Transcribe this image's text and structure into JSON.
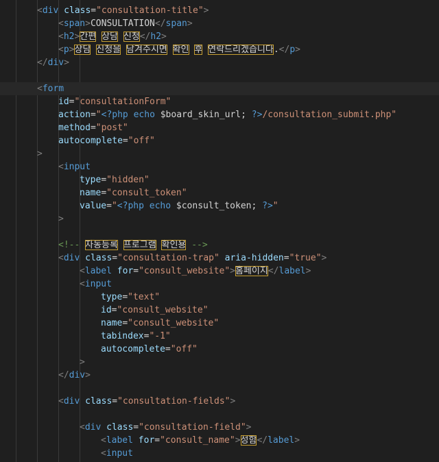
{
  "editor": {
    "lines": [
      {
        "indent": 1,
        "tokens": [
          [
            "p",
            "<"
          ],
          [
            "t",
            "div"
          ],
          [
            "x",
            " "
          ],
          [
            "a",
            "class"
          ],
          [
            "x",
            "="
          ],
          [
            "s",
            "\"consultation-title\""
          ],
          [
            "p",
            ">"
          ]
        ]
      },
      {
        "indent": 2,
        "tokens": [
          [
            "p",
            "<"
          ],
          [
            "t",
            "span"
          ],
          [
            "p",
            ">"
          ],
          [
            "x",
            "CONSULTATION"
          ],
          [
            "p",
            "</"
          ],
          [
            "t",
            "span"
          ],
          [
            "p",
            ">"
          ]
        ]
      },
      {
        "indent": 2,
        "tokens": [
          [
            "p",
            "<"
          ],
          [
            "t",
            "h2"
          ],
          [
            "p",
            ">"
          ],
          [
            "hl",
            "간편"
          ],
          [
            "x",
            " "
          ],
          [
            "hl",
            "상담"
          ],
          [
            "x",
            " "
          ],
          [
            "hl",
            "신청"
          ],
          [
            "p",
            "</"
          ],
          [
            "t",
            "h2"
          ],
          [
            "p",
            ">"
          ]
        ]
      },
      {
        "indent": 2,
        "tokens": [
          [
            "p",
            "<"
          ],
          [
            "t",
            "p"
          ],
          [
            "p",
            ">"
          ],
          [
            "hl",
            "상담"
          ],
          [
            "x",
            " "
          ],
          [
            "hl",
            "신청을"
          ],
          [
            "x",
            " "
          ],
          [
            "hl",
            "남겨주시면"
          ],
          [
            "x",
            " "
          ],
          [
            "hl",
            "확인"
          ],
          [
            "x",
            " "
          ],
          [
            "hl",
            "후"
          ],
          [
            "x",
            " "
          ],
          [
            "hl",
            "연락드리겠습니다"
          ],
          [
            "x",
            "."
          ],
          [
            "p",
            "</"
          ],
          [
            "t",
            "p"
          ],
          [
            "p",
            ">"
          ]
        ]
      },
      {
        "indent": 1,
        "tokens": [
          [
            "p",
            "</"
          ],
          [
            "t",
            "div"
          ],
          [
            "p",
            ">"
          ]
        ]
      },
      {
        "indent": 0,
        "tokens": []
      },
      {
        "indent": 1,
        "active": true,
        "tokens": [
          [
            "p",
            "<"
          ],
          [
            "t",
            "form"
          ]
        ]
      },
      {
        "indent": 2,
        "tokens": [
          [
            "a",
            "id"
          ],
          [
            "x",
            "="
          ],
          [
            "s",
            "\"consultationForm\""
          ]
        ]
      },
      {
        "indent": 2,
        "tokens": [
          [
            "a",
            "action"
          ],
          [
            "x",
            "="
          ],
          [
            "s",
            "\""
          ],
          [
            "t",
            "<?php"
          ],
          [
            "x",
            " "
          ],
          [
            "t",
            "echo"
          ],
          [
            "x",
            " $board_skin_url; "
          ],
          [
            "t",
            "?>"
          ],
          [
            "s",
            "/consultation_submit.php\""
          ]
        ]
      },
      {
        "indent": 2,
        "tokens": [
          [
            "a",
            "method"
          ],
          [
            "x",
            "="
          ],
          [
            "s",
            "\"post\""
          ]
        ]
      },
      {
        "indent": 2,
        "tokens": [
          [
            "a",
            "autocomplete"
          ],
          [
            "x",
            "="
          ],
          [
            "s",
            "\"off\""
          ]
        ]
      },
      {
        "indent": 1,
        "tokens": [
          [
            "p",
            ">"
          ]
        ]
      },
      {
        "indent": 2,
        "tokens": [
          [
            "p",
            "<"
          ],
          [
            "t",
            "input"
          ]
        ]
      },
      {
        "indent": 3,
        "tokens": [
          [
            "a",
            "type"
          ],
          [
            "x",
            "="
          ],
          [
            "s",
            "\"hidden\""
          ]
        ]
      },
      {
        "indent": 3,
        "tokens": [
          [
            "a",
            "name"
          ],
          [
            "x",
            "="
          ],
          [
            "s",
            "\"consult_token\""
          ]
        ]
      },
      {
        "indent": 3,
        "tokens": [
          [
            "a",
            "value"
          ],
          [
            "x",
            "="
          ],
          [
            "s",
            "\""
          ],
          [
            "t",
            "<?php"
          ],
          [
            "x",
            " "
          ],
          [
            "t",
            "echo"
          ],
          [
            "x",
            " $consult_token; "
          ],
          [
            "t",
            "?>"
          ],
          [
            "s",
            "\""
          ]
        ]
      },
      {
        "indent": 2,
        "tokens": [
          [
            "p",
            ">"
          ]
        ]
      },
      {
        "indent": 0,
        "tokens": []
      },
      {
        "indent": 2,
        "tokens": [
          [
            "c",
            "<!-- "
          ],
          [
            "hl",
            "자동등록"
          ],
          [
            "c",
            " "
          ],
          [
            "hl",
            "프로그램"
          ],
          [
            "c",
            " "
          ],
          [
            "hl",
            "확인용"
          ],
          [
            "c",
            " -->"
          ]
        ]
      },
      {
        "indent": 2,
        "tokens": [
          [
            "p",
            "<"
          ],
          [
            "t",
            "div"
          ],
          [
            "x",
            " "
          ],
          [
            "a",
            "class"
          ],
          [
            "x",
            "="
          ],
          [
            "s",
            "\"consultation-trap\""
          ],
          [
            "x",
            " "
          ],
          [
            "a",
            "aria-hidden"
          ],
          [
            "x",
            "="
          ],
          [
            "s",
            "\"true\""
          ],
          [
            "p",
            ">"
          ]
        ]
      },
      {
        "indent": 3,
        "tokens": [
          [
            "p",
            "<"
          ],
          [
            "t",
            "label"
          ],
          [
            "x",
            " "
          ],
          [
            "a",
            "for"
          ],
          [
            "x",
            "="
          ],
          [
            "s",
            "\"consult_website\""
          ],
          [
            "p",
            ">"
          ],
          [
            "hl",
            "홈페이지"
          ],
          [
            "p",
            "</"
          ],
          [
            "t",
            "label"
          ],
          [
            "p",
            ">"
          ]
        ]
      },
      {
        "indent": 3,
        "tokens": [
          [
            "p",
            "<"
          ],
          [
            "t",
            "input"
          ]
        ]
      },
      {
        "indent": 4,
        "tokens": [
          [
            "a",
            "type"
          ],
          [
            "x",
            "="
          ],
          [
            "s",
            "\"text\""
          ]
        ]
      },
      {
        "indent": 4,
        "tokens": [
          [
            "a",
            "id"
          ],
          [
            "x",
            "="
          ],
          [
            "s",
            "\"consult_website\""
          ]
        ]
      },
      {
        "indent": 4,
        "tokens": [
          [
            "a",
            "name"
          ],
          [
            "x",
            "="
          ],
          [
            "s",
            "\"consult_website\""
          ]
        ]
      },
      {
        "indent": 4,
        "tokens": [
          [
            "a",
            "tabindex"
          ],
          [
            "x",
            "="
          ],
          [
            "s",
            "\"-1\""
          ]
        ]
      },
      {
        "indent": 4,
        "tokens": [
          [
            "a",
            "autocomplete"
          ],
          [
            "x",
            "="
          ],
          [
            "s",
            "\"off\""
          ]
        ]
      },
      {
        "indent": 3,
        "tokens": [
          [
            "p",
            ">"
          ]
        ]
      },
      {
        "indent": 2,
        "tokens": [
          [
            "p",
            "</"
          ],
          [
            "t",
            "div"
          ],
          [
            "p",
            ">"
          ]
        ]
      },
      {
        "indent": 0,
        "tokens": []
      },
      {
        "indent": 2,
        "tokens": [
          [
            "p",
            "<"
          ],
          [
            "t",
            "div"
          ],
          [
            "x",
            " "
          ],
          [
            "a",
            "class"
          ],
          [
            "x",
            "="
          ],
          [
            "s",
            "\"consultation-fields\""
          ],
          [
            "p",
            ">"
          ]
        ]
      },
      {
        "indent": 0,
        "tokens": []
      },
      {
        "indent": 3,
        "tokens": [
          [
            "p",
            "<"
          ],
          [
            "t",
            "div"
          ],
          [
            "x",
            " "
          ],
          [
            "a",
            "class"
          ],
          [
            "x",
            "="
          ],
          [
            "s",
            "\"consultation-field\""
          ],
          [
            "p",
            ">"
          ]
        ]
      },
      {
        "indent": 4,
        "tokens": [
          [
            "p",
            "<"
          ],
          [
            "t",
            "label"
          ],
          [
            "x",
            " "
          ],
          [
            "a",
            "for"
          ],
          [
            "x",
            "="
          ],
          [
            "s",
            "\"consult_name\""
          ],
          [
            "p",
            ">"
          ],
          [
            "hl",
            "성함"
          ],
          [
            "p",
            "</"
          ],
          [
            "t",
            "label"
          ],
          [
            "p",
            ">"
          ]
        ]
      },
      {
        "indent": 4,
        "tokens": [
          [
            "p",
            "<"
          ],
          [
            "t",
            "input"
          ]
        ]
      }
    ]
  }
}
